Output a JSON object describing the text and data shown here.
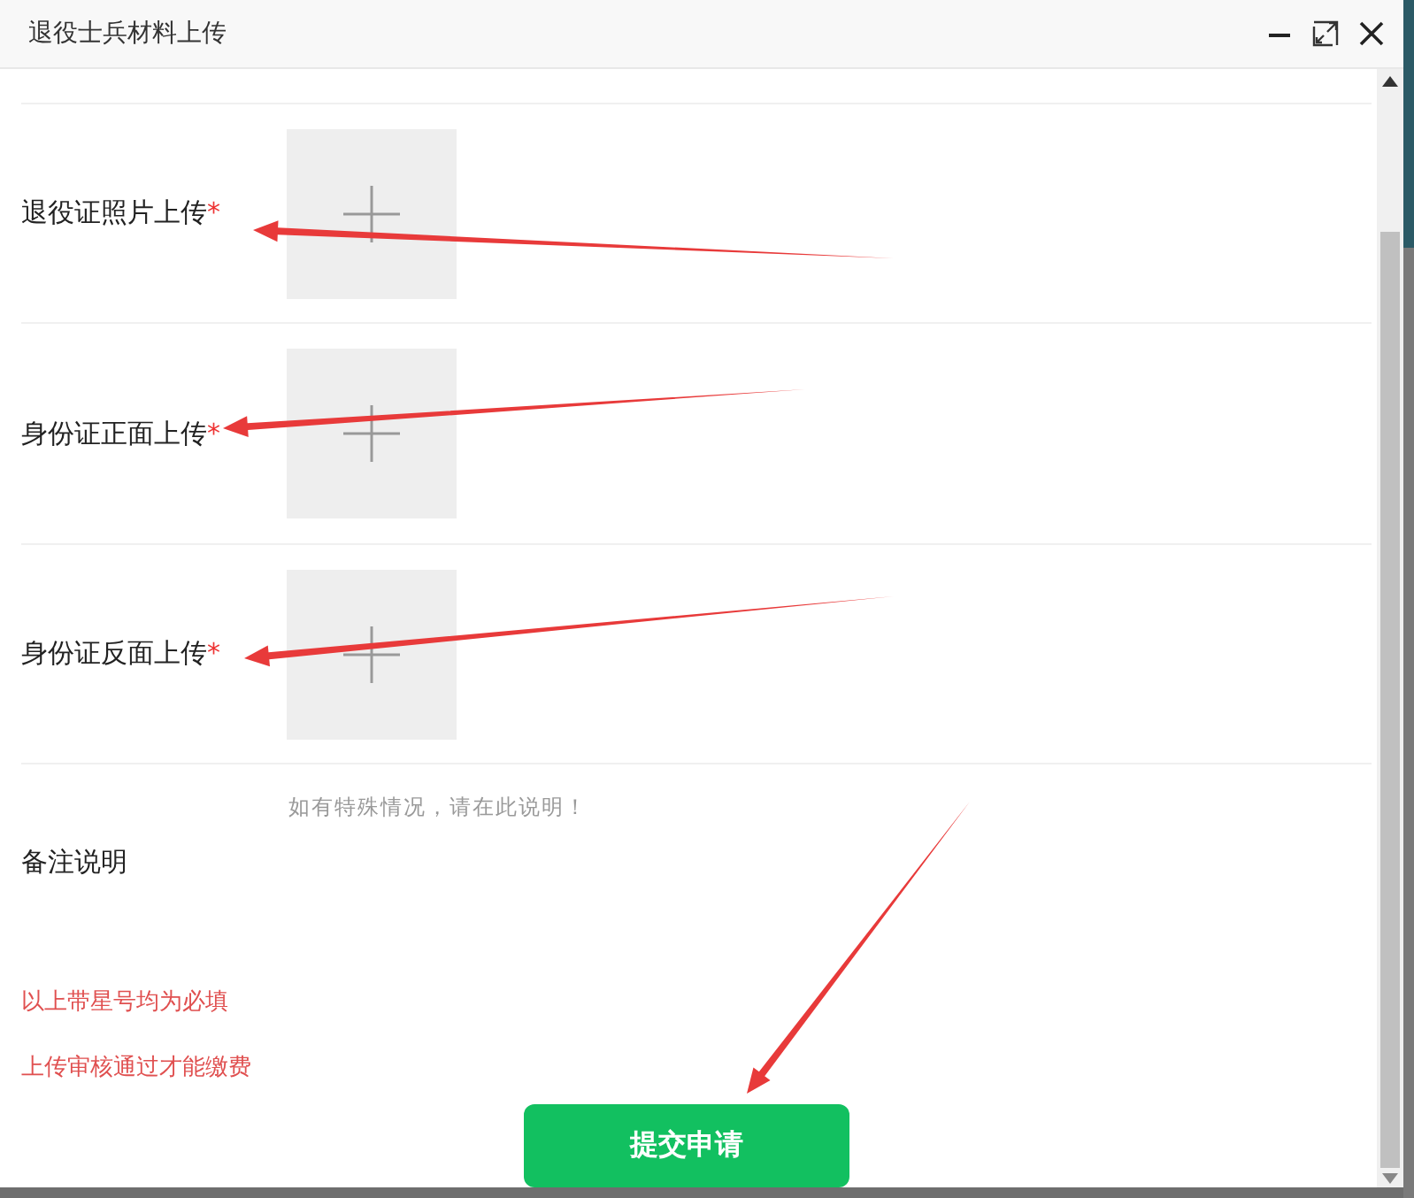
{
  "window": {
    "title": "退役士兵材料上传"
  },
  "upload_fields": [
    {
      "label": "退役证照片上传",
      "required_mark": "*"
    },
    {
      "label": "身份证正面上传",
      "required_mark": "*"
    },
    {
      "label": "身份证反面上传",
      "required_mark": "*"
    }
  ],
  "remark": {
    "label": "备注说明",
    "placeholder": "如有特殊情况，请在此说明！"
  },
  "notes": [
    "以上带星号均为必填",
    "上传审核通过才能缴费"
  ],
  "submit_button": "提交申请"
}
